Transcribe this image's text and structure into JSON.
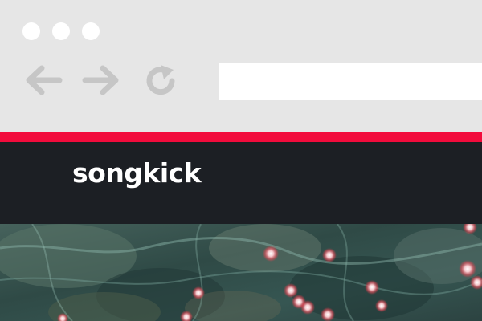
{
  "browser": {
    "window_controls": [
      "close-dot",
      "minimize-dot",
      "maximize-dot"
    ],
    "nav": {
      "back_icon": "arrow-left-icon",
      "forward_icon": "arrow-right-icon",
      "reload_icon": "reload-icon"
    },
    "address_bar": {
      "value": "",
      "placeholder": ""
    },
    "colors": {
      "chrome": "#e6e6e6",
      "icon": "#c6c6c6"
    }
  },
  "site": {
    "logo_text": "songkick",
    "colors": {
      "accent_stripe": "#f20c3c",
      "header": "#1c1f24",
      "logo": "#ffffff"
    }
  },
  "hero": {
    "image": "crowd-lights-photo"
  }
}
